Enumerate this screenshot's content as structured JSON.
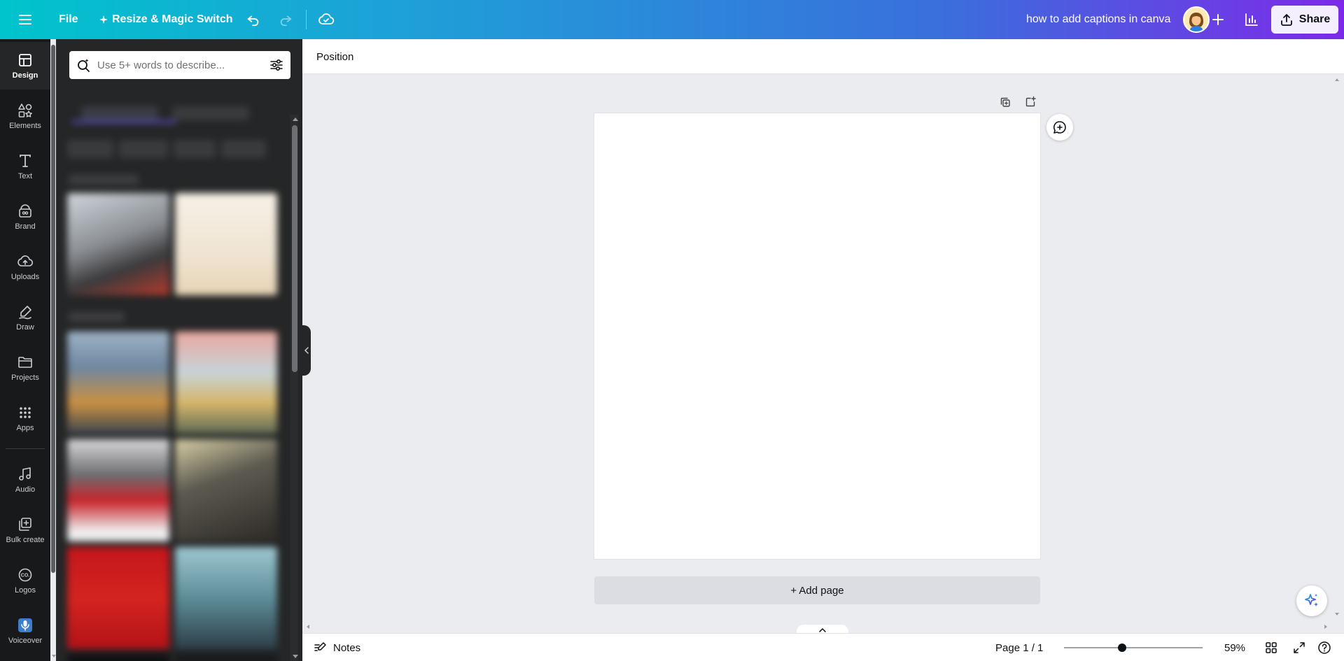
{
  "header": {
    "file_label": "File",
    "resize_label": "Resize & Magic Switch",
    "design_title": "how to add captions in canva",
    "share_label": "Share"
  },
  "rail": {
    "items": [
      {
        "label": "Design",
        "icon": "layout-icon"
      },
      {
        "label": "Elements",
        "icon": "shapes-icon"
      },
      {
        "label": "Text",
        "icon": "text-icon"
      },
      {
        "label": "Brand",
        "icon": "brand-icon"
      },
      {
        "label": "Uploads",
        "icon": "cloud-upload-icon"
      },
      {
        "label": "Draw",
        "icon": "pen-icon"
      },
      {
        "label": "Projects",
        "icon": "folder-icon"
      },
      {
        "label": "Apps",
        "icon": "grid-icon"
      },
      {
        "label": "Audio",
        "icon": "music-note-icon"
      },
      {
        "label": "Bulk create",
        "icon": "bulk-create-icon"
      },
      {
        "label": "Logos",
        "icon": "logo-icon"
      },
      {
        "label": "Voiceover",
        "icon": "voiceover-icon"
      }
    ]
  },
  "panel": {
    "search_placeholder": "Use 5+ words to describe..."
  },
  "toolbar": {
    "position_label": "Position"
  },
  "editor": {
    "add_page_label": "+ Add page"
  },
  "footer": {
    "notes_label": "Notes",
    "page_count": "Page 1 / 1",
    "zoom": "59%",
    "zoom_fraction": 0.42
  },
  "colors": {
    "header_start": "#00c4cc",
    "header_end": "#7d2ae8",
    "rail_bg": "#18191b",
    "panel_bg": "#252627",
    "canvas_bg": "#ebecf0"
  }
}
